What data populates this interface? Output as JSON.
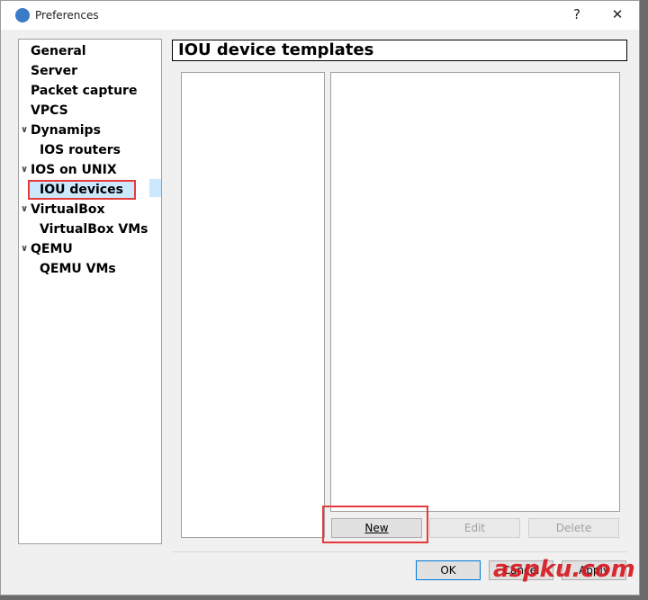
{
  "window": {
    "title": "Preferences",
    "help": "?",
    "close": "✕"
  },
  "tree": [
    {
      "label": "General",
      "level": 0
    },
    {
      "label": "Server",
      "level": 0
    },
    {
      "label": "Packet capture",
      "level": 0
    },
    {
      "label": "VPCS",
      "level": 0
    },
    {
      "label": "Dynamips",
      "level": 0,
      "expanded": true
    },
    {
      "label": "IOS routers",
      "level": 1
    },
    {
      "label": "IOS on UNIX",
      "level": 0,
      "expanded": true
    },
    {
      "label": "IOU devices",
      "level": 1,
      "selected": true
    },
    {
      "label": "VirtualBox",
      "level": 0,
      "expanded": true
    },
    {
      "label": "VirtualBox VMs",
      "level": 1
    },
    {
      "label": "QEMU",
      "level": 0,
      "expanded": true
    },
    {
      "label": "QEMU VMs",
      "level": 1
    }
  ],
  "page": {
    "title": "IOU device templates"
  },
  "buttons": {
    "new": "New",
    "edit": "Edit",
    "delete": "Delete",
    "ok": "OK",
    "cancel": "Cancel",
    "apply": "Apply"
  },
  "watermark": "aspku.com",
  "colors": {
    "highlight": "#e53b3b",
    "selection": "#cce8ff"
  }
}
